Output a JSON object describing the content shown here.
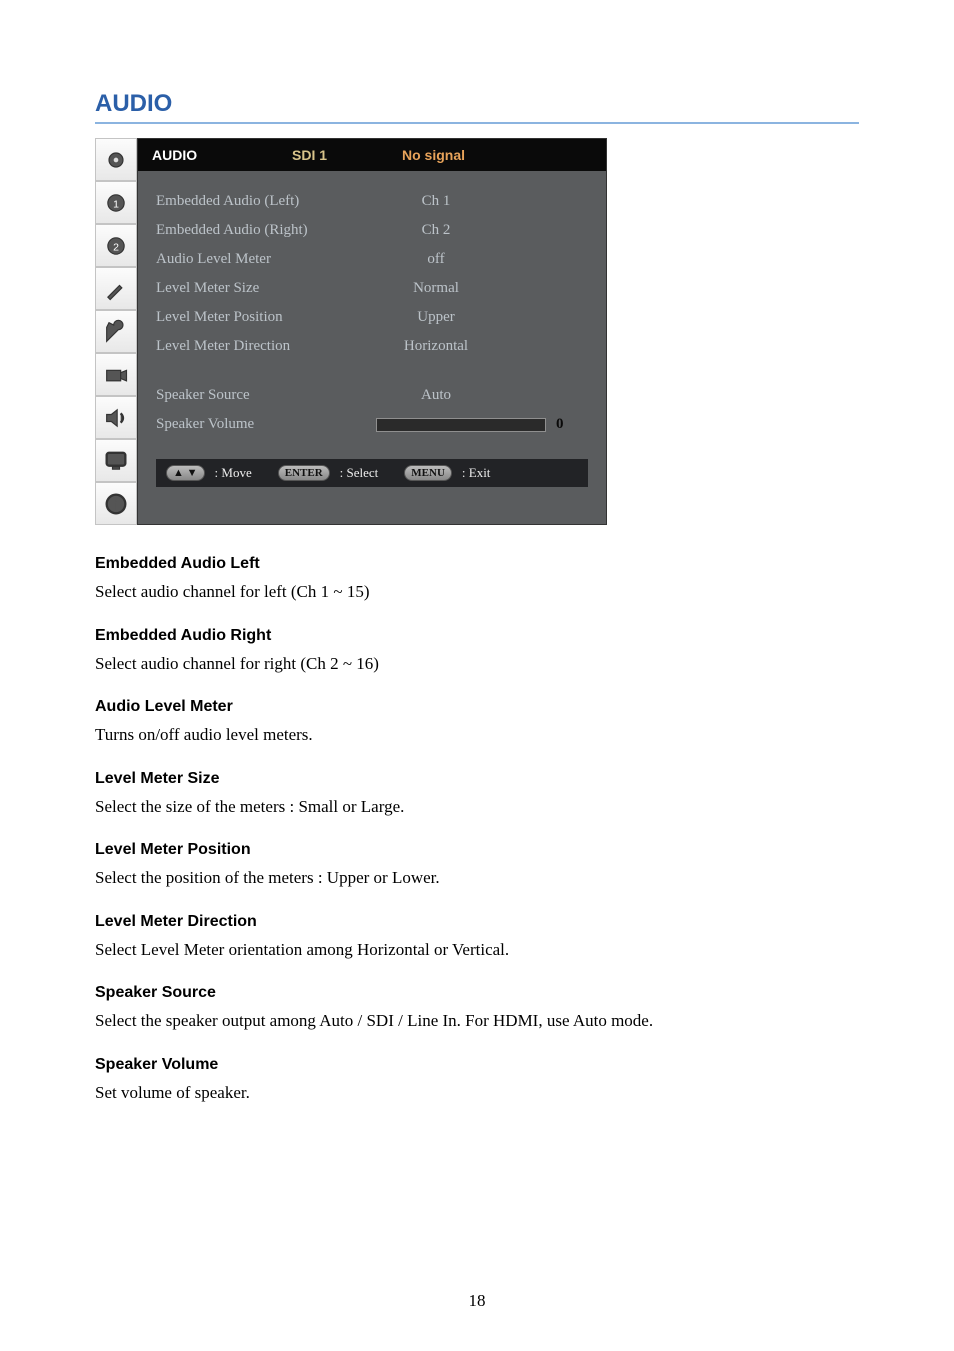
{
  "pageTitle": "AUDIO",
  "osd": {
    "header": {
      "title": "AUDIO",
      "source": "SDI 1",
      "signal": "No signal"
    },
    "rows": [
      {
        "label": "Embedded Audio (Left)",
        "value": "Ch   1"
      },
      {
        "label": "Embedded Audio (Right)",
        "value": "Ch   2"
      },
      {
        "label": "Audio Level Meter",
        "value": "off"
      },
      {
        "label": "Level Meter Size",
        "value": "Normal"
      },
      {
        "label": "Level Meter Position",
        "value": "Upper"
      },
      {
        "label": "Level Meter Direction",
        "value": "Horizontal"
      }
    ],
    "rows2": [
      {
        "label": "Speaker Source",
        "value": "Auto"
      }
    ],
    "volume": {
      "label": "Speaker Volume",
      "value": "0"
    },
    "footer": {
      "moveKey": "▲ ▼",
      "moveLabel": ": Move",
      "selectKey": "ENTER",
      "selectLabel": ": Select",
      "exitKey": "MENU",
      "exitLabel": ": Exit"
    }
  },
  "sections": [
    {
      "title": "Embedded Audio Left",
      "body": "Select audio channel for left (Ch 1 ~ 15)"
    },
    {
      "title": "Embedded Audio Right",
      "body": "Select audio channel for right (Ch 2 ~ 16)"
    },
    {
      "title": "Audio Level Meter",
      "body": "Turns on/off audio level meters."
    },
    {
      "title": "Level Meter Size",
      "body": "Select the size of the meters : Small or Large."
    },
    {
      "title": "Level Meter Position",
      "body": "Select the position of the meters : Upper or Lower."
    },
    {
      "title": "Level Meter Direction",
      "body": "Select Level Meter orientation among Horizontal or Vertical."
    },
    {
      "title": "Speaker Source",
      "body": "Select the speaker output among Auto / SDI / Line In. For HDMI, use Auto mode."
    },
    {
      "title": "Speaker Volume",
      "body": "Set volume of speaker."
    }
  ],
  "pageNumber": "18",
  "icons": [
    "gear-icon",
    "gear1-icon",
    "gear2-icon",
    "tools-icon",
    "wrench-icon",
    "camera-icon",
    "speaker-icon",
    "monitor-icon",
    "info-icon"
  ]
}
